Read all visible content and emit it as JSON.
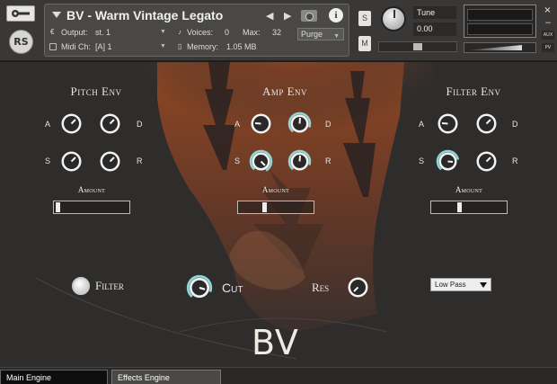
{
  "header": {
    "instrument_name": "BV - Warm Vintage Legato",
    "logo_text": "RS",
    "output_label": "Output:",
    "output_value": "st. 1",
    "midi_label": "Midi Ch:",
    "midi_value": "[A]  1",
    "voices_label": "Voices:",
    "voices_value": "0",
    "max_label": "Max:",
    "max_value": "32",
    "memory_label": "Memory:",
    "memory_value": "1.05 MB",
    "purge_label": "Purge",
    "solo_label": "S",
    "mute_label": "M",
    "tune_label": "Tune",
    "tune_value": "0.00",
    "aux_label": "AUX",
    "pv_label": "PV",
    "minimize_label": "−",
    "close_label": "×",
    "info_label": "i"
  },
  "sections": {
    "pitch_env": {
      "title": "Pitch Env",
      "amount_label": "Amount",
      "amount_level": 0.02
    },
    "amp_env": {
      "title": "Amp Env",
      "amount_label": "Amount",
      "amount_level": 0.35
    },
    "filter_env": {
      "title": "Filter Env",
      "amount_label": "Amount",
      "amount_level": 0.38
    }
  },
  "adsr": {
    "a": "A",
    "d": "D",
    "s": "S",
    "r": "R"
  },
  "controls": {
    "filter_label": "Filter",
    "cut_label": "Cut",
    "res_label": "Res",
    "filter_type": "Low Pass"
  },
  "brand": {
    "logo": "BV"
  },
  "tabs": {
    "main_engine": "Main Engine",
    "effects_engine": "Effects Engine"
  },
  "colors": {
    "knob_ring": "#8fd6d8",
    "panel_bg": "#2e2d2c",
    "sunset": "#b8571e"
  }
}
